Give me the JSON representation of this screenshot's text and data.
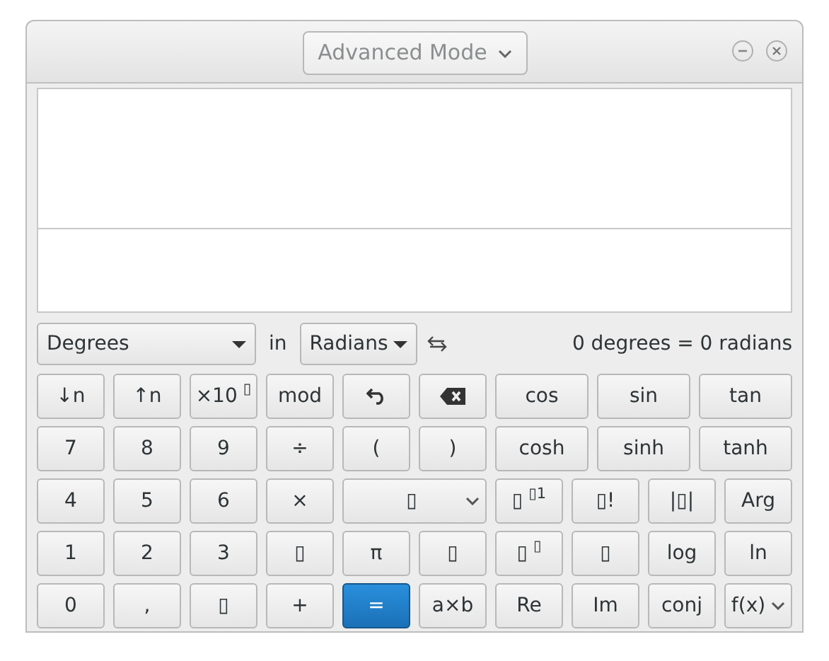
{
  "window": {
    "title": "Advanced Mode"
  },
  "converter": {
    "from": "Degrees",
    "in_label": "in",
    "to": "Radians",
    "result": "0 degrees = 0 radians"
  },
  "keypad": [
    [
      {
        "label": "↓n",
        "kind": "key"
      },
      {
        "label": "↑n",
        "kind": "key"
      },
      {
        "label": "×10$^{▯}$",
        "kind": "key"
      },
      {
        "label": "mod",
        "kind": "key"
      },
      {
        "kind": "icon-undo"
      },
      {
        "kind": "icon-backspace"
      },
      {
        "label": "cos",
        "kind": "key"
      },
      {
        "label": "sin",
        "kind": "key"
      },
      {
        "label": "tan",
        "kind": "key"
      }
    ],
    [
      {
        "label": "7",
        "kind": "key"
      },
      {
        "label": "8",
        "kind": "key"
      },
      {
        "label": "9",
        "kind": "key"
      },
      {
        "label": "÷",
        "kind": "key"
      },
      {
        "label": "(",
        "kind": "key"
      },
      {
        "label": ")",
        "kind": "key"
      },
      {
        "label": "cosh",
        "kind": "key"
      },
      {
        "label": "sinh",
        "kind": "key"
      },
      {
        "label": "tanh",
        "kind": "key"
      }
    ],
    [
      {
        "label": "4",
        "kind": "key"
      },
      {
        "label": "5",
        "kind": "key"
      },
      {
        "label": "6",
        "kind": "key"
      },
      {
        "label": "×",
        "kind": "key"
      },
      {
        "label": "▯",
        "kind": "dropdown"
      },
      {
        "label": "▯$^{▯1}$",
        "kind": "key"
      },
      {
        "label": "▯!",
        "kind": "key"
      },
      {
        "label": "|▯|",
        "kind": "key"
      },
      {
        "label": "Arg",
        "kind": "key"
      }
    ],
    [
      {
        "label": "1",
        "kind": "key"
      },
      {
        "label": "2",
        "kind": "key"
      },
      {
        "label": "3",
        "kind": "key"
      },
      {
        "label": "▯",
        "kind": "key"
      },
      {
        "label": "π",
        "kind": "key"
      },
      {
        "label": "▯",
        "kind": "key"
      },
      {
        "label": "▯$^{▯}$",
        "kind": "key"
      },
      {
        "label": "▯",
        "kind": "key"
      },
      {
        "label": "log",
        "kind": "key"
      },
      {
        "label": "ln",
        "kind": "key"
      }
    ],
    [
      {
        "label": "0",
        "kind": "key"
      },
      {
        "label": ",",
        "kind": "key"
      },
      {
        "label": "▯",
        "kind": "key"
      },
      {
        "label": "+",
        "kind": "key"
      },
      {
        "label": "=",
        "kind": "primary"
      },
      {
        "label": "a×b",
        "kind": "key"
      },
      {
        "label": "Re",
        "kind": "key"
      },
      {
        "label": "Im",
        "kind": "key"
      },
      {
        "label": "conj",
        "kind": "key"
      },
      {
        "label": "f(x)",
        "kind": "dropdown"
      }
    ]
  ]
}
